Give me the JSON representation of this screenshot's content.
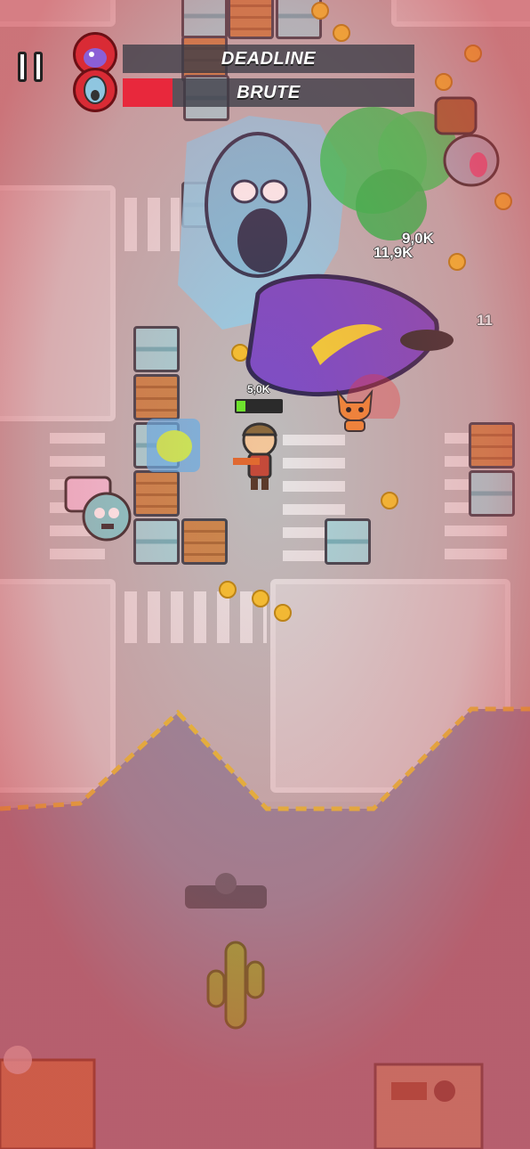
{
  "hud": {
    "pause_icon": "pause-icon",
    "bosses": [
      {
        "name": "DEADLINE",
        "health": 0.0,
        "avatar_icon": "purple-boss-avatar-icon"
      },
      {
        "name": "BRUTE",
        "health": 0.17,
        "avatar_icon": "zombie-boss-avatar-icon"
      }
    ]
  },
  "player": {
    "health_label": "5,0K",
    "health": 0.2
  },
  "damage_numbers": [
    "9,0K",
    "11,9K",
    "11"
  ],
  "colors": {
    "danger_overlay": "#e04a55",
    "boss_bar_fill": "#e8283c",
    "player_health_fill": "#6ee32e",
    "coin": "#f4c531",
    "poison_cloud": "#2fd15a"
  }
}
